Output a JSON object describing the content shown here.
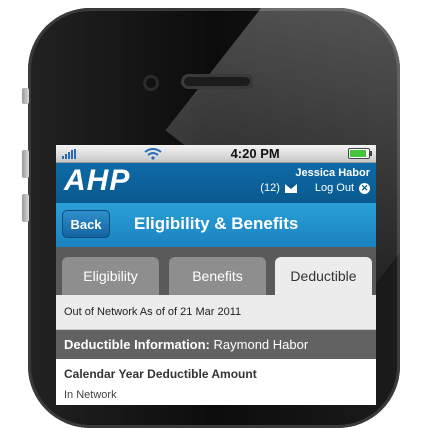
{
  "status_bar": {
    "time": "4:20 PM"
  },
  "header": {
    "logo": "AHP",
    "user_name": "Jessica Habor",
    "message_count": "(12)",
    "logout_label": "Log Out"
  },
  "title_bar": {
    "back_label": "Back",
    "title": "Eligibility & Benefits"
  },
  "tabs": [
    {
      "label": "Eligibility"
    },
    {
      "label": "Benefits"
    },
    {
      "label": "Deductible"
    }
  ],
  "active_tab": "Deductible",
  "content": {
    "network_date": "Out of Network As of of 21 Mar 2011",
    "deductible_info_label": "Deductible Information:",
    "deductible_info_name": "Raymond Habor",
    "section_title": "Calendar Year Deductible Amount",
    "section_sub": "In Network"
  },
  "colors": {
    "header": "#0a5a8e",
    "title_bar": "#1a82bf",
    "tab_bar": "#5a5a5a"
  }
}
